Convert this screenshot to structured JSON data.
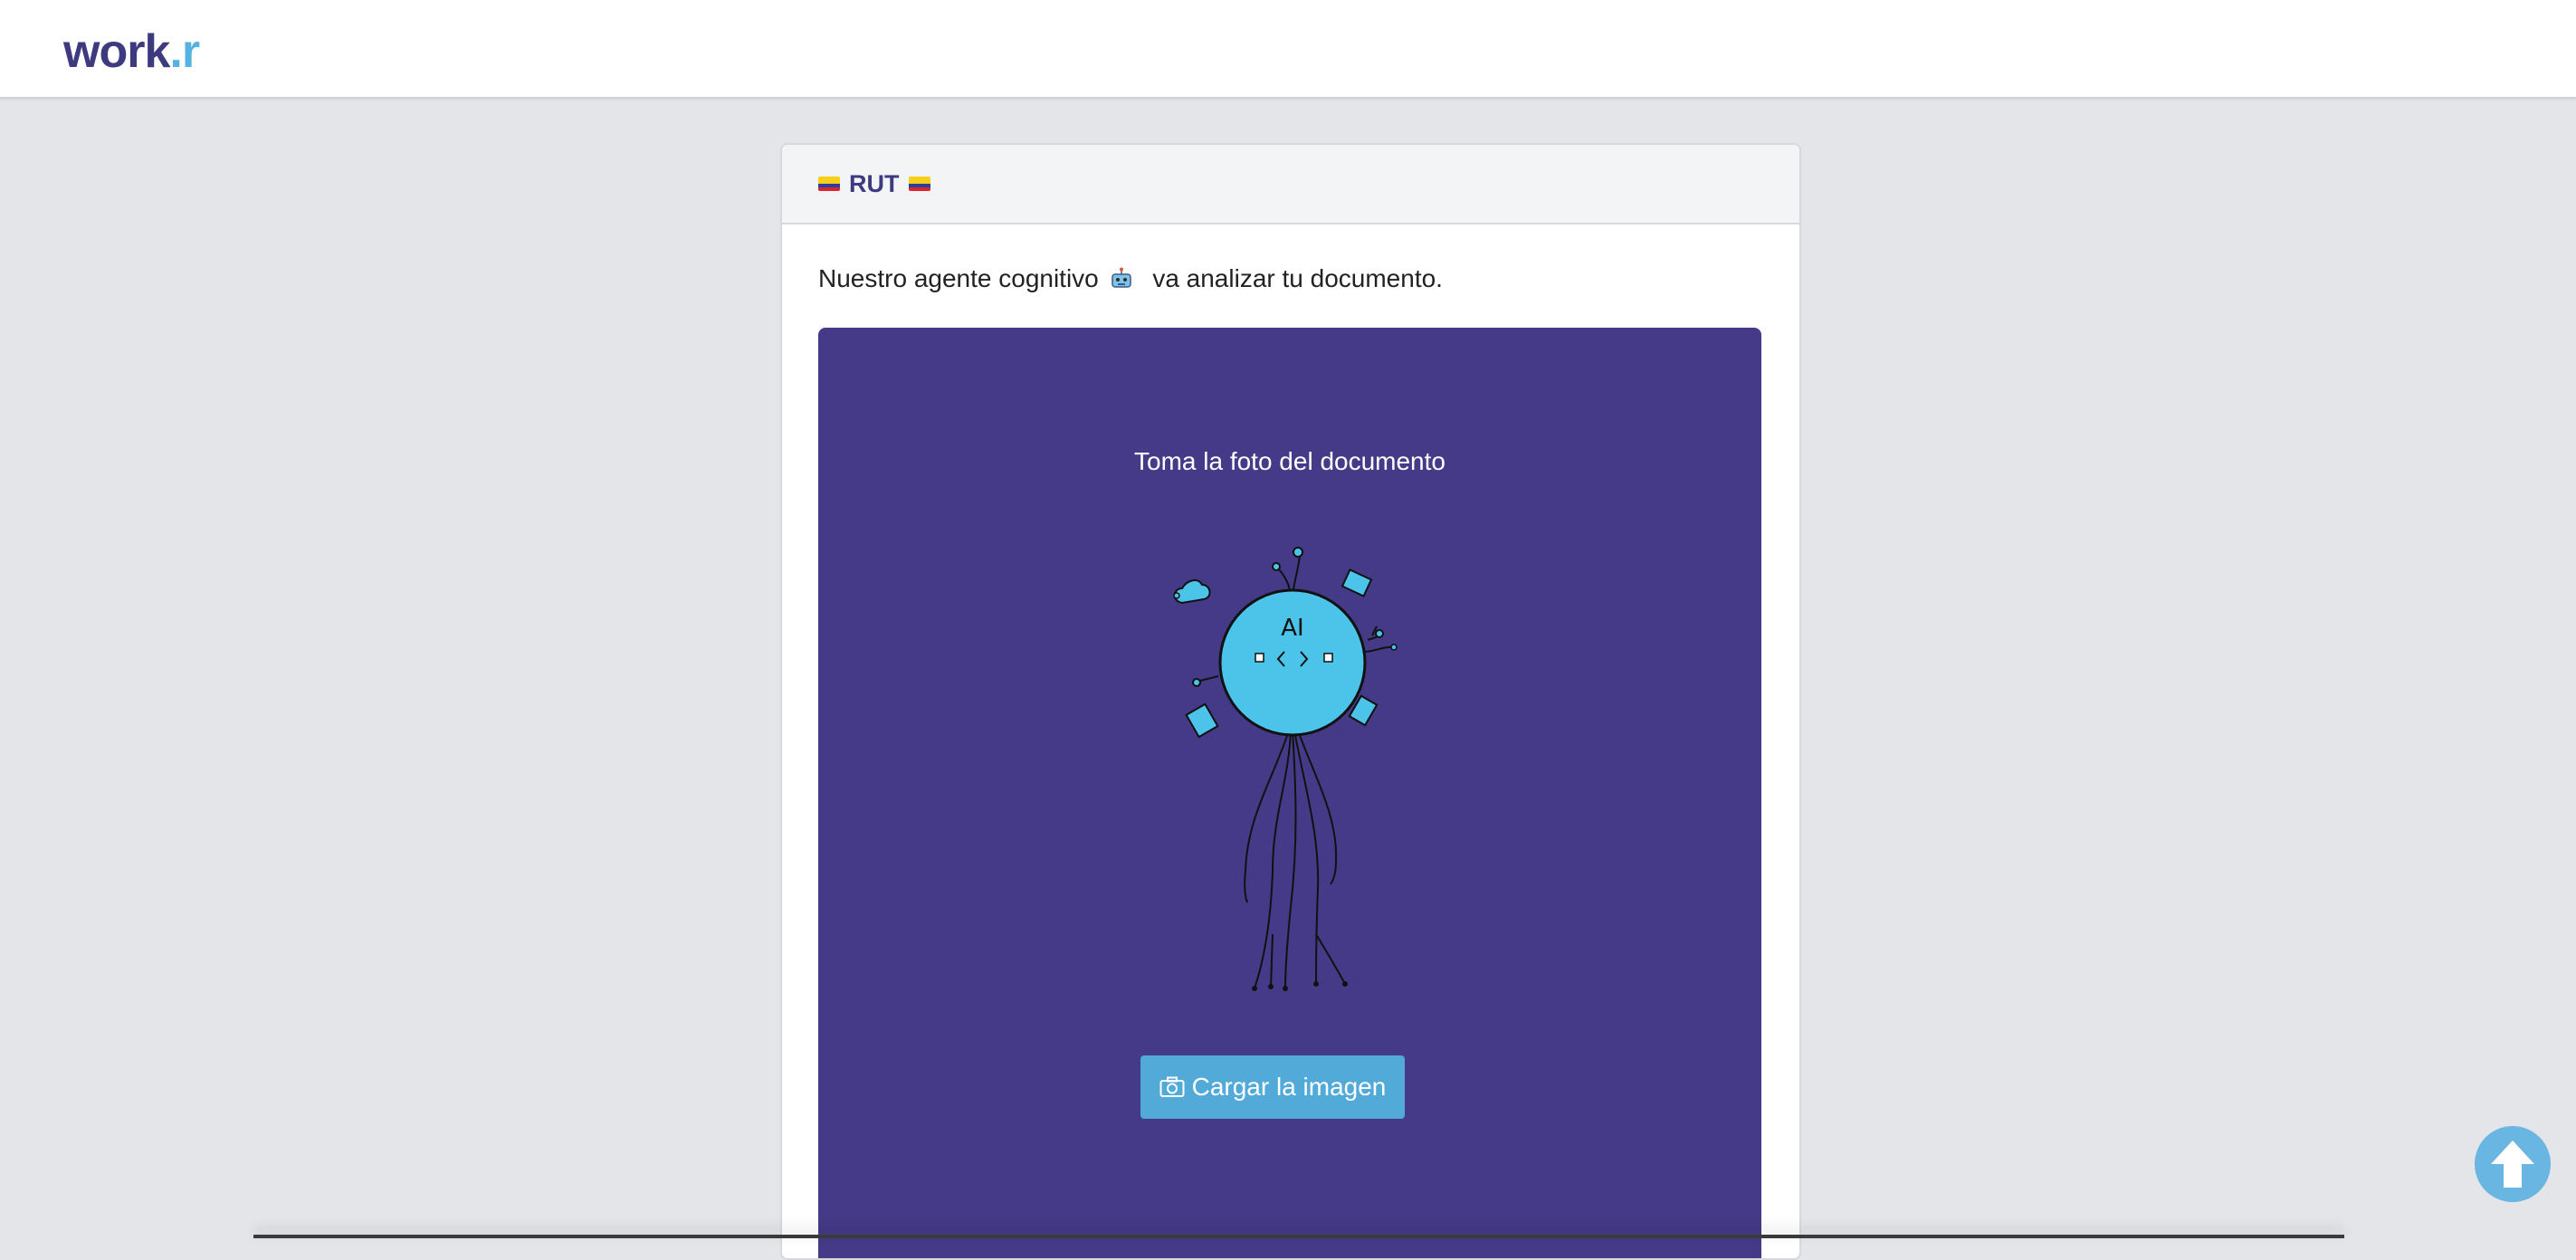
{
  "brand": {
    "logo_main": "work",
    "logo_dot": ".",
    "logo_end": "r"
  },
  "card": {
    "title": "RUT",
    "intro_before": "Nuestro agente cognitivo",
    "intro_after": "va analizar tu documento.",
    "panel_title": "Toma la foto del documento",
    "illustration_text": "AI",
    "upload_button": "Cargar la imagen"
  },
  "icons": {
    "flag": "colombia-flag-icon",
    "robot": "robot-icon",
    "camera": "camera-icon",
    "scroll_top": "arrow-up-circle-icon"
  },
  "colors": {
    "brand": "#3e3a80",
    "accent": "#56b3e0",
    "panel": "#443a87",
    "button": "#52aad8"
  }
}
